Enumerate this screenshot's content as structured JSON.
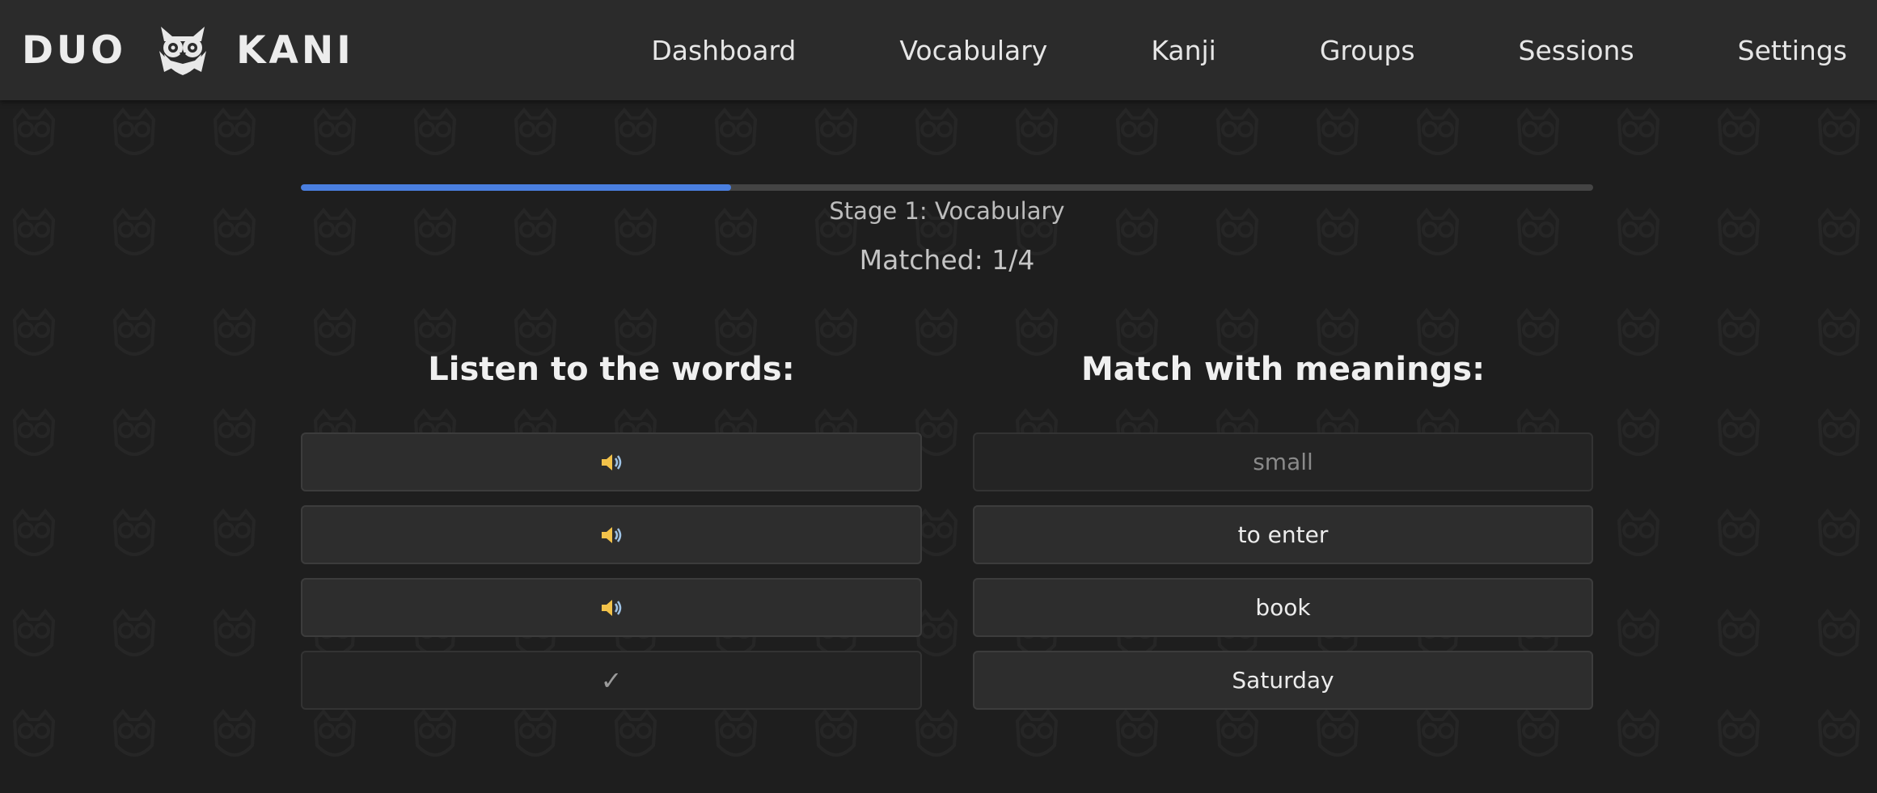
{
  "header": {
    "brand_left": "DUO",
    "brand_right": "KANI",
    "logo_icon": "owl-icon",
    "nav": [
      {
        "label": "Dashboard"
      },
      {
        "label": "Vocabulary"
      },
      {
        "label": "Kanji"
      },
      {
        "label": "Groups"
      },
      {
        "label": "Sessions"
      },
      {
        "label": "Settings"
      }
    ]
  },
  "quiz": {
    "progress_fraction": 0.333,
    "stage_label": "Stage 1: Vocabulary",
    "matched_text": "Matched: 1/4",
    "left_title": "Listen to the words:",
    "right_title": "Match with meanings:",
    "audio_tiles": [
      {
        "icon": "speaker-icon",
        "state": "active"
      },
      {
        "icon": "speaker-icon",
        "state": "active"
      },
      {
        "icon": "speaker-icon",
        "state": "active"
      },
      {
        "icon": "check-icon",
        "state": "matched",
        "glyph": "✓"
      }
    ],
    "meanings": [
      {
        "label": "small",
        "state": "matched"
      },
      {
        "label": "to enter",
        "state": "active"
      },
      {
        "label": "book",
        "state": "active"
      },
      {
        "label": "Saturday",
        "state": "active"
      }
    ]
  },
  "colors": {
    "accent": "#4a7fe0",
    "background": "#1e1e1e",
    "header": "#2b2b2b",
    "tile": "#2d2d2d"
  }
}
